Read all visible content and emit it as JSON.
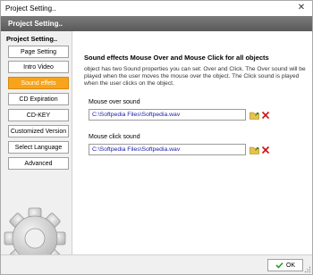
{
  "window": {
    "title": "Project Setting.."
  },
  "header": {
    "title": "Project Setting.."
  },
  "sidebar": {
    "title": "Project Setting..",
    "items": [
      {
        "label": "Page Setting"
      },
      {
        "label": "Intro Video"
      },
      {
        "label": "Sound effets"
      },
      {
        "label": "CD Expiration"
      },
      {
        "label": "CD-KEY"
      },
      {
        "label": "Customized Version"
      },
      {
        "label": "Select Language"
      },
      {
        "label": "Advanced"
      }
    ],
    "active_index": 2
  },
  "main": {
    "section_title": "Sound effects Mouse Over and Mouse Click for all objects",
    "description": "object has two Sound properties you can set: Over and Click. The Over sound will be played when the user moves the mouse over the object. The Click sound is played when the user clicks on the object.",
    "mouse_over": {
      "label": "Mouse over sound",
      "value": "C:\\Softpedia Files\\Softpedia.wav"
    },
    "mouse_click": {
      "label": "Mouse click sound",
      "value": "C:\\Softpedia Files\\Softpedia.wav"
    }
  },
  "footer": {
    "ok_label": "OK"
  },
  "colors": {
    "accent": "#f7a31c",
    "header_bg": "#6a6a6a",
    "path_text": "#1a1aa8",
    "delete_red": "#cc1111"
  }
}
